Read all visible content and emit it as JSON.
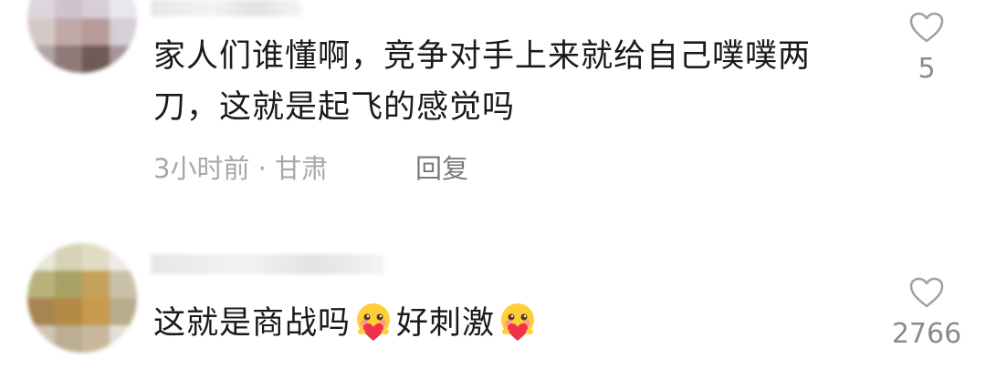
{
  "comments": [
    {
      "text": "家人们谁懂啊，竞争对手上来就给自己噗噗两刀，这就是起飞的感觉吗",
      "meta": "3小时前 · 甘肃",
      "reply_label": "回复",
      "likes": "5"
    },
    {
      "text_part1": "这就是商战吗",
      "text_part2": "好刺激",
      "emoji_icon": "blushing-heart-emoji",
      "likes": "2766"
    }
  ],
  "colors": {
    "text": "#1a1a1a",
    "meta": "#a8a8a8",
    "heart_outline": "#a0a0a0"
  }
}
